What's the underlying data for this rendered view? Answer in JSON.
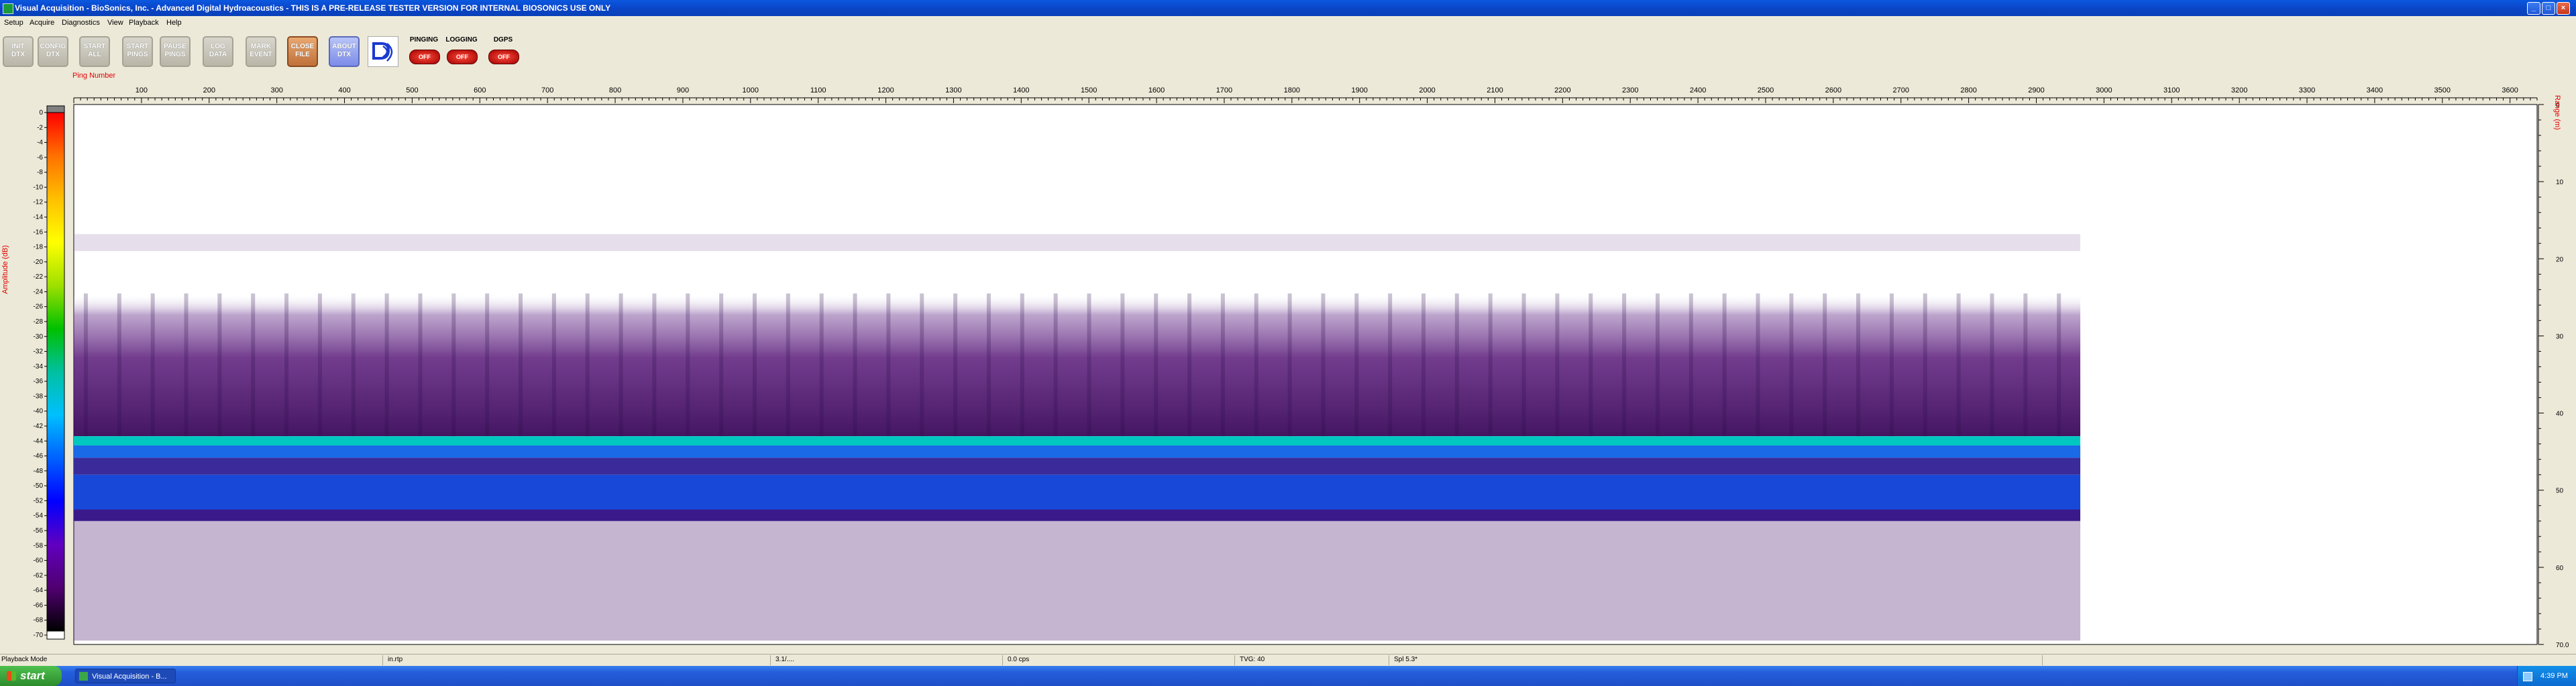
{
  "window": {
    "title": "Visual Acquisition  -  BioSonics, Inc.  -  Advanced Digital Hydroacoustics  -  THIS IS A PRE-RELEASE TESTER VERSION FOR INTERNAL BIOSONICS USE ONLY",
    "controls": {
      "minimize": "_",
      "maximize": "□",
      "close": "×"
    }
  },
  "menu": [
    "Setup",
    "Acquire",
    "Diagnostics",
    "View",
    "Playback",
    "Help"
  ],
  "toolbar": {
    "buttons": [
      {
        "label1": "INIT",
        "label2": "DTX",
        "style": "gray"
      },
      {
        "label1": "CONFIG",
        "label2": "DTX",
        "style": "gray"
      },
      {
        "label1": "START",
        "label2": "ALL",
        "style": "gray"
      },
      {
        "label1": "START",
        "label2": "PINGS",
        "style": "gray"
      },
      {
        "label1": "PAUSE",
        "label2": "PINGS",
        "style": "gray"
      },
      {
        "label1": "LOG",
        "label2": "DATA",
        "style": "gray"
      },
      {
        "label1": "MARK",
        "label2": "EVENT",
        "style": "gray"
      },
      {
        "label1": "CLOSE",
        "label2": "FILE",
        "style": "orange"
      },
      {
        "label1": "ABOUT",
        "label2": "DTX",
        "style": "blue"
      }
    ],
    "indicators": [
      {
        "label": "PINGING",
        "state": "OFF"
      },
      {
        "label": "LOGGING",
        "state": "OFF"
      },
      {
        "label": "DGPS",
        "state": "OFF"
      }
    ],
    "logo_icon": "biosonics-logo-icon"
  },
  "echogram": {
    "x_axis_title": "Ping Number",
    "y_left_title": "Amplitude (dB)",
    "y_right_title": "Range (m)",
    "x_ticks": [
      100,
      200,
      300,
      400,
      500,
      600,
      700,
      800,
      900,
      1000,
      1100,
      1200,
      1300,
      1400,
      1500,
      1600,
      1700,
      1800,
      1900,
      2000,
      2100,
      2200,
      2300,
      2400,
      2500,
      2600,
      2700,
      2800,
      2900,
      3000,
      3100,
      3200,
      3300,
      3400,
      3500,
      3600
    ],
    "x_max": 3640,
    "data_end_ping": 2965,
    "amplitude_ticks": [
      0,
      -2,
      -4,
      -6,
      -8,
      -10,
      -12,
      -14,
      -16,
      -18,
      -20,
      -22,
      -24,
      -26,
      -28,
      -30,
      -32,
      -34,
      -36,
      -38,
      -40,
      -42,
      -44,
      -46,
      -48,
      -50,
      -52,
      -54,
      -56,
      -58,
      -60,
      -62,
      -64,
      -66,
      -68,
      -70
    ],
    "range_ticks": [
      0,
      10,
      20,
      30,
      40,
      50,
      60,
      70.0
    ],
    "range_tick_labels": [
      "0",
      "10",
      "20",
      "30",
      "40",
      "50",
      "60",
      "70.0"
    ],
    "range_max": 70,
    "colormap": [
      "#ff0000",
      "#ff7000",
      "#ffc000",
      "#ffff00",
      "#a0e000",
      "#00c000",
      "#00c0a0",
      "#00c0ff",
      "#0060ff",
      "#0000ff",
      "#6000c0",
      "#500070",
      "#000000"
    ]
  },
  "statusbar": {
    "mode": "Playback Mode",
    "cells": [
      "in.rtp",
      "3.1/....",
      "0.0 cps",
      "TVG: 40",
      "Spl 5.3*"
    ]
  },
  "taskbar": {
    "start": "start",
    "task": "Visual Acquisition - B...",
    "clock": "4:39 PM"
  }
}
